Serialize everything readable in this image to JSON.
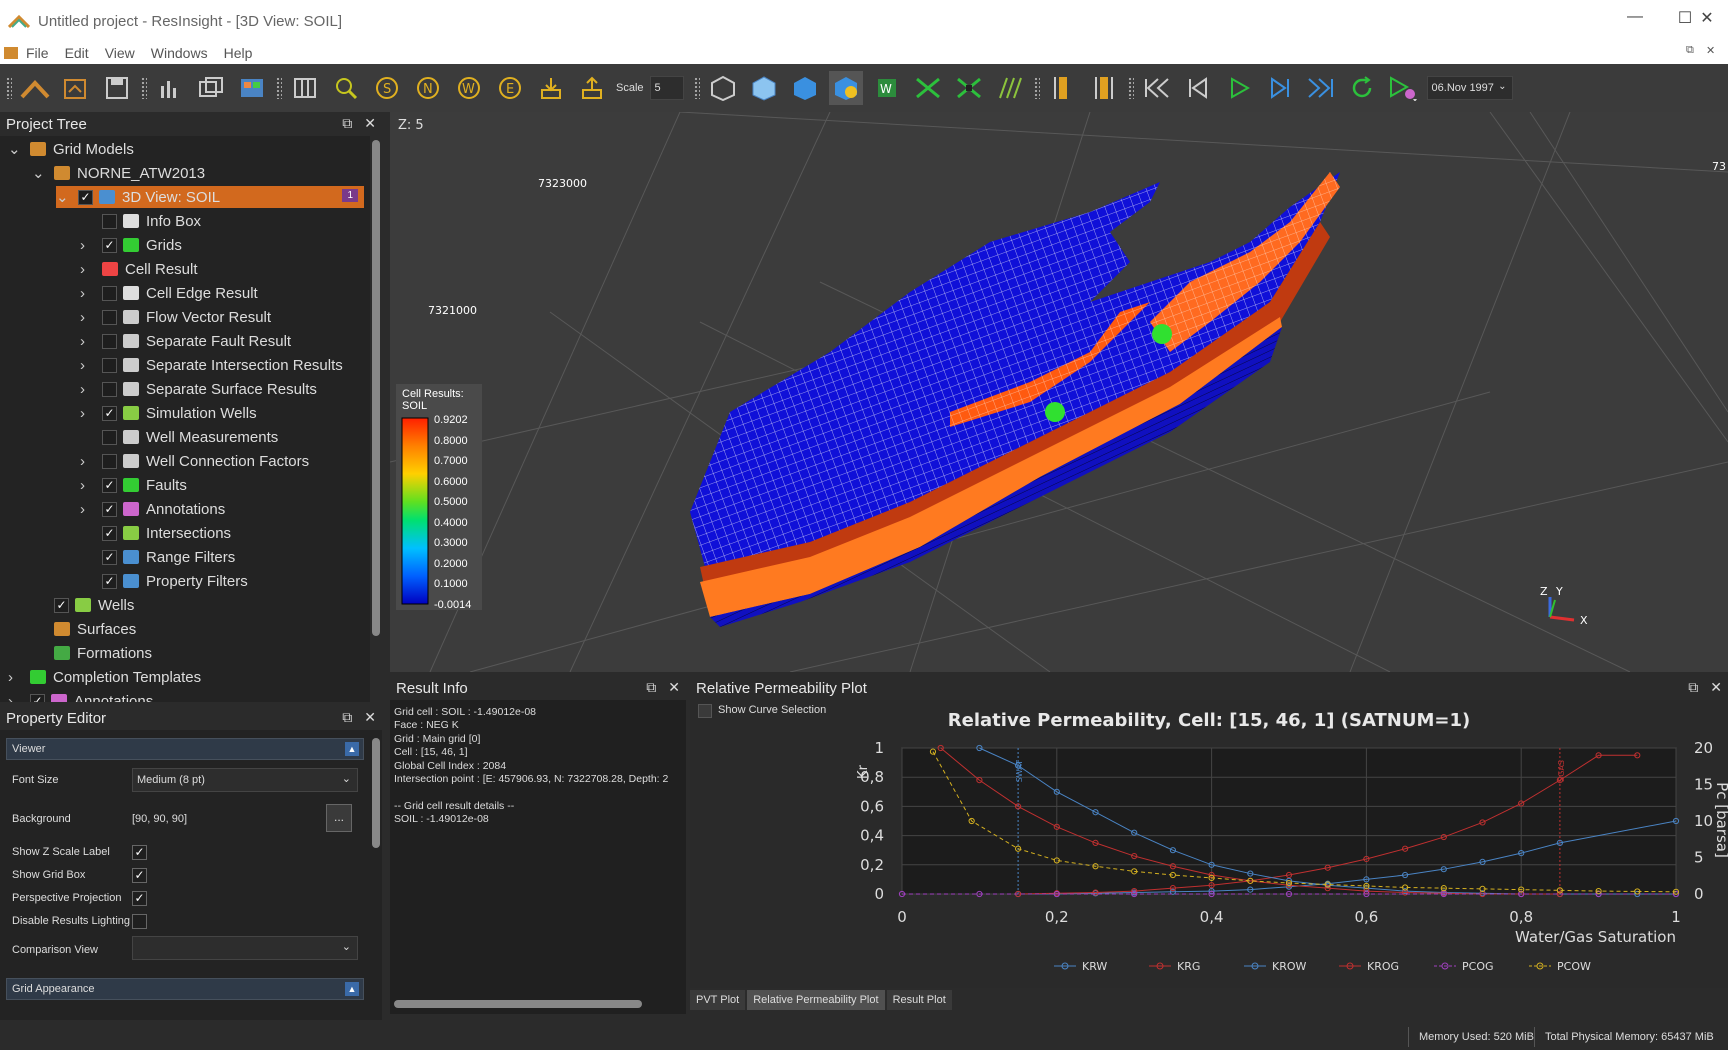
{
  "window": {
    "title": "Untitled project - ResInsight - [3D View: SOIL]"
  },
  "menu": [
    "File",
    "Edit",
    "View",
    "Windows",
    "Help"
  ],
  "toolbar": {
    "scale_label": "Scale",
    "scale_value": "5",
    "date": "06.Nov 1997"
  },
  "project_tree": {
    "title": "Project Tree",
    "items": [
      {
        "label": "Grid Models",
        "indent": 0,
        "arrow": "v",
        "check": null,
        "icon": "grid-models-icon",
        "color": "#d08a30"
      },
      {
        "label": "NORNE_ATW2013",
        "indent": 1,
        "arrow": "v",
        "check": null,
        "icon": "case-icon",
        "color": "#d08a30"
      },
      {
        "label": "3D View: SOIL",
        "indent": 2,
        "arrow": "v",
        "check": true,
        "icon": "view-3d-icon",
        "color": "#4a8fd0",
        "selected": true,
        "badge": "1"
      },
      {
        "label": "Info Box",
        "indent": 3,
        "arrow": "",
        "check": false,
        "icon": "info-box-icon",
        "color": "#ddd"
      },
      {
        "label": "Grids",
        "indent": 3,
        "arrow": ">",
        "check": true,
        "icon": "grids-icon",
        "color": "#3c3"
      },
      {
        "label": "Cell Result",
        "indent": 3,
        "arrow": ">",
        "check": null,
        "icon": "cell-result-icon",
        "color": "#e44"
      },
      {
        "label": "Cell Edge Result",
        "indent": 3,
        "arrow": ">",
        "check": false,
        "icon": "cell-edge-icon",
        "color": "#ddd"
      },
      {
        "label": "Flow Vector Result",
        "indent": 3,
        "arrow": ">",
        "check": false,
        "icon": "flow-vector-icon",
        "color": "#ccc"
      },
      {
        "label": "Separate Fault Result",
        "indent": 3,
        "arrow": ">",
        "check": false,
        "icon": "fault-result-icon",
        "color": "#ccc"
      },
      {
        "label": "Separate Intersection Results",
        "indent": 3,
        "arrow": ">",
        "check": false,
        "icon": "intersection-result-icon",
        "color": "#ccc"
      },
      {
        "label": "Separate Surface Results",
        "indent": 3,
        "arrow": ">",
        "check": false,
        "icon": "surface-result-icon",
        "color": "#ccc"
      },
      {
        "label": "Simulation Wells",
        "indent": 3,
        "arrow": ">",
        "check": true,
        "icon": "simulation-wells-icon",
        "color": "#8c4"
      },
      {
        "label": "Well Measurements",
        "indent": 3,
        "arrow": "",
        "check": false,
        "icon": "well-measurements-icon",
        "color": "#ccc"
      },
      {
        "label": "Well Connection Factors",
        "indent": 3,
        "arrow": ">",
        "check": false,
        "icon": "connection-factors-icon",
        "color": "#ccc"
      },
      {
        "label": "Faults",
        "indent": 3,
        "arrow": ">",
        "check": true,
        "icon": "faults-icon",
        "color": "#3c3"
      },
      {
        "label": "Annotations",
        "indent": 3,
        "arrow": ">",
        "check": true,
        "icon": "annotations-icon",
        "color": "#c6c"
      },
      {
        "label": "Intersections",
        "indent": 3,
        "arrow": "",
        "check": true,
        "icon": "intersections-icon",
        "color": "#8c4"
      },
      {
        "label": "Range Filters",
        "indent": 3,
        "arrow": "",
        "check": true,
        "icon": "range-filter-icon",
        "color": "#4a8fd0"
      },
      {
        "label": "Property Filters",
        "indent": 3,
        "arrow": "",
        "check": true,
        "icon": "property-filter-icon",
        "color": "#4a8fd0"
      },
      {
        "label": "Wells",
        "indent": 1,
        "arrow": "",
        "check": true,
        "icon": "wells-icon",
        "color": "#8c4"
      },
      {
        "label": "Surfaces",
        "indent": 1,
        "arrow": "",
        "check": null,
        "icon": "surfaces-icon",
        "color": "#d08a30"
      },
      {
        "label": "Formations",
        "indent": 1,
        "arrow": "",
        "check": null,
        "icon": "formations-icon",
        "color": "#4a4"
      },
      {
        "label": "Completion Templates",
        "indent": 0,
        "arrow": ">",
        "check": null,
        "icon": "completion-templates-icon",
        "color": "#3c3"
      },
      {
        "label": "Annotations",
        "indent": 0,
        "arrow": ">",
        "check": true,
        "icon": "annotations-icon",
        "color": "#c6c"
      }
    ]
  },
  "property_editor": {
    "title": "Property Editor",
    "viewer_section": "Viewer",
    "font_size_label": "Font Size",
    "font_size_value": "Medium (8 pt)",
    "background_label": "Background",
    "background_value": "[90, 90, 90]",
    "browse": "...",
    "checks": [
      {
        "label": "Show Z Scale Label",
        "checked": true
      },
      {
        "label": "Show Grid Box",
        "checked": true
      },
      {
        "label": "Perspective Projection",
        "checked": true
      },
      {
        "label": "Disable Results Lighting",
        "checked": false
      }
    ],
    "comparison_label": "Comparison View",
    "comparison_value": "",
    "grid_section": "Grid Appearance"
  },
  "view3d": {
    "z_label": "Z: 5",
    "coord1": "7323000",
    "coord2": "7321000",
    "coord3": "73",
    "legend_title": "Cell Results:",
    "legend_sub": "SOIL",
    "legend_ticks": [
      "0.9202",
      "0.8000",
      "0.7000",
      "0.6000",
      "0.5000",
      "0.4000",
      "0.3000",
      "0.2000",
      "0.1000",
      "-0.0014"
    ],
    "axis_z": "Z",
    "axis_y": "Y",
    "axis_x": "X"
  },
  "result_info": {
    "title": "Result Info",
    "lines": [
      "Grid cell : SOIL : -1.49012e-08",
      "Face : NEG K",
      "Grid : Main grid [0]",
      "Cell : [15, 46, 1]",
      "Global Cell Index : 2084",
      "Intersection point : [E: 457906.93, N: 7322708.28, Depth: 2",
      "",
      "-- Grid cell result details --",
      "SOIL : -1.49012e-08"
    ]
  },
  "relperm": {
    "title": "Relative Permeability Plot",
    "show_curve_selection": "Show Curve Selection",
    "tabs": [
      "PVT Plot",
      "Relative Permeability Plot",
      "Result Plot"
    ]
  },
  "status": {
    "memory_used": "Memory Used: 520 MiB",
    "total_memory": "Total Physical Memory: 65437 MiB"
  },
  "chart_data": {
    "type": "line",
    "title": "Relative Permeability, Cell: [15, 46, 1] (SATNUM=1)",
    "xlabel": "Water/Gas Saturation",
    "ylabel": "Kr",
    "y2label": "Pc [barsa]",
    "xlim": [
      0,
      1
    ],
    "ylim": [
      0,
      1
    ],
    "y2lim": [
      0,
      20
    ],
    "xticks": [
      "0",
      "0,2",
      "0,4",
      "0,6",
      "0,8",
      "1"
    ],
    "yticks": [
      "0",
      "0,2",
      "0,4",
      "0,6",
      "0,8",
      "1"
    ],
    "y2ticks": [
      "0",
      "5",
      "10",
      "15",
      "20"
    ],
    "markers": [
      {
        "x": 0.15,
        "label": "SWAT"
      },
      {
        "x": 0.85,
        "label": "SGAS"
      }
    ],
    "series": [
      {
        "name": "KRW",
        "color": "#4a84c4",
        "axis": "left",
        "x": [
          0.15,
          0.2,
          0.25,
          0.3,
          0.35,
          0.4,
          0.45,
          0.5,
          0.55,
          0.6,
          0.65,
          0.7,
          0.75,
          0.8,
          0.85,
          1.0
        ],
        "y": [
          0,
          0,
          0.005,
          0.01,
          0.015,
          0.02,
          0.03,
          0.05,
          0.07,
          0.1,
          0.13,
          0.17,
          0.22,
          0.28,
          0.35,
          0.5
        ]
      },
      {
        "name": "KRG",
        "color": "#c03030",
        "axis": "left",
        "x": [
          0.15,
          0.2,
          0.25,
          0.3,
          0.35,
          0.4,
          0.45,
          0.5,
          0.55,
          0.6,
          0.65,
          0.7,
          0.75,
          0.8,
          0.85,
          0.9,
          0.95
        ],
        "y": [
          0,
          0.005,
          0.01,
          0.02,
          0.04,
          0.06,
          0.09,
          0.13,
          0.18,
          0.24,
          0.31,
          0.39,
          0.49,
          0.62,
          0.78,
          0.95,
          0.95
        ]
      },
      {
        "name": "KROW",
        "color": "#4a84c4",
        "axis": "left",
        "x": [
          0.1,
          0.15,
          0.2,
          0.25,
          0.3,
          0.35,
          0.4,
          0.45,
          0.5,
          0.55,
          0.6,
          0.65,
          0.7,
          0.75,
          0.8,
          0.85,
          0.9,
          0.95,
          1.0
        ],
        "y": [
          1.0,
          0.88,
          0.7,
          0.56,
          0.42,
          0.3,
          0.2,
          0.14,
          0.09,
          0.06,
          0.04,
          0.02,
          0.01,
          0.005,
          0,
          0,
          0,
          0,
          0
        ]
      },
      {
        "name": "KROG",
        "color": "#c03030",
        "axis": "left",
        "x": [
          0.05,
          0.1,
          0.15,
          0.2,
          0.25,
          0.3,
          0.35,
          0.4,
          0.45,
          0.5,
          0.55,
          0.6,
          0.65,
          0.7,
          0.75,
          0.8,
          0.85
        ],
        "y": [
          1.0,
          0.78,
          0.6,
          0.46,
          0.35,
          0.26,
          0.19,
          0.13,
          0.09,
          0.06,
          0.04,
          0.02,
          0.01,
          0.005,
          0,
          0,
          0
        ]
      },
      {
        "name": "PCOG",
        "color": "#a040c0",
        "axis": "right",
        "x": [
          0,
          0.1,
          0.2,
          0.3,
          0.4,
          0.5,
          0.6,
          0.7,
          0.8,
          0.9,
          1.0
        ],
        "y": [
          0,
          0,
          0,
          0,
          0,
          0,
          0,
          0,
          0,
          0,
          0
        ]
      },
      {
        "name": "PCOW",
        "color": "#d4b020",
        "axis": "right",
        "x": [
          0.04,
          0.09,
          0.15,
          0.2,
          0.25,
          0.3,
          0.35,
          0.4,
          0.45,
          0.5,
          0.55,
          0.6,
          0.65,
          0.7,
          0.75,
          0.8,
          0.85,
          0.9,
          0.95,
          1.0
        ],
        "y": [
          19.5,
          10,
          6.2,
          4.6,
          3.8,
          3.1,
          2.6,
          2.2,
          1.8,
          1.5,
          1.3,
          1.1,
          0.9,
          0.8,
          0.7,
          0.6,
          0.5,
          0.4,
          0.35,
          0.3
        ]
      }
    ]
  }
}
